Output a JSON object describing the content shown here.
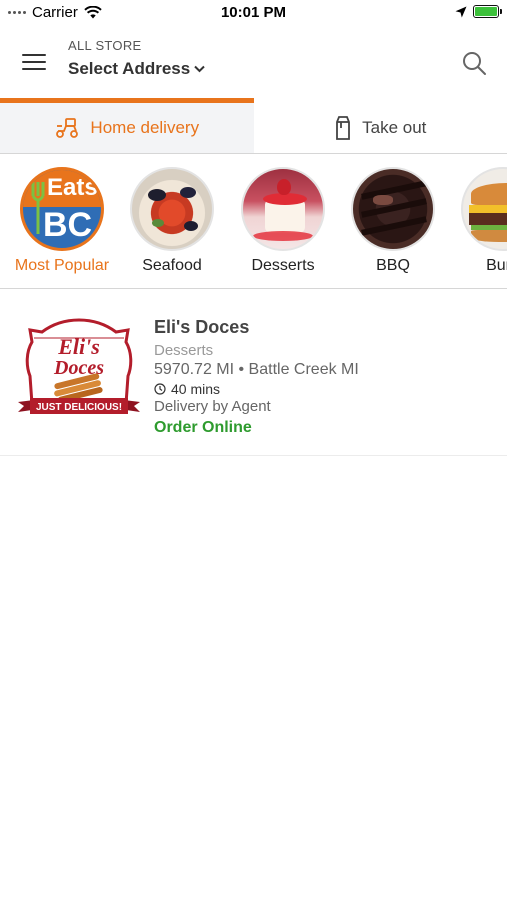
{
  "status_bar": {
    "carrier": "Carrier",
    "time": "10:01 PM"
  },
  "header": {
    "store_label": "ALL STORE",
    "address_label": "Select Address"
  },
  "tabs": [
    {
      "label": "Home delivery",
      "active": true
    },
    {
      "label": "Take out",
      "active": false
    }
  ],
  "categories": [
    {
      "label": "Most Popular",
      "selected": true,
      "logo_text_top": "Eats",
      "logo_text_bottom": "BC"
    },
    {
      "label": "Seafood",
      "selected": false
    },
    {
      "label": "Desserts",
      "selected": false
    },
    {
      "label": "BBQ",
      "selected": false
    },
    {
      "label": "Burg",
      "selected": false
    }
  ],
  "stores": [
    {
      "name": "Eli's Doces",
      "category": "Desserts",
      "distance": "5970.72 MI • Battle Creek MI",
      "time": "40 mins",
      "delivery": "Delivery by Agent",
      "action": "Order Online",
      "logo_text_top": "Eli's",
      "logo_text_mid": "Doces",
      "logo_ribbon": "JUST DELICIOUS!"
    }
  ],
  "colors": {
    "accent": "#e8741c",
    "order_green": "#2e9b2e"
  }
}
